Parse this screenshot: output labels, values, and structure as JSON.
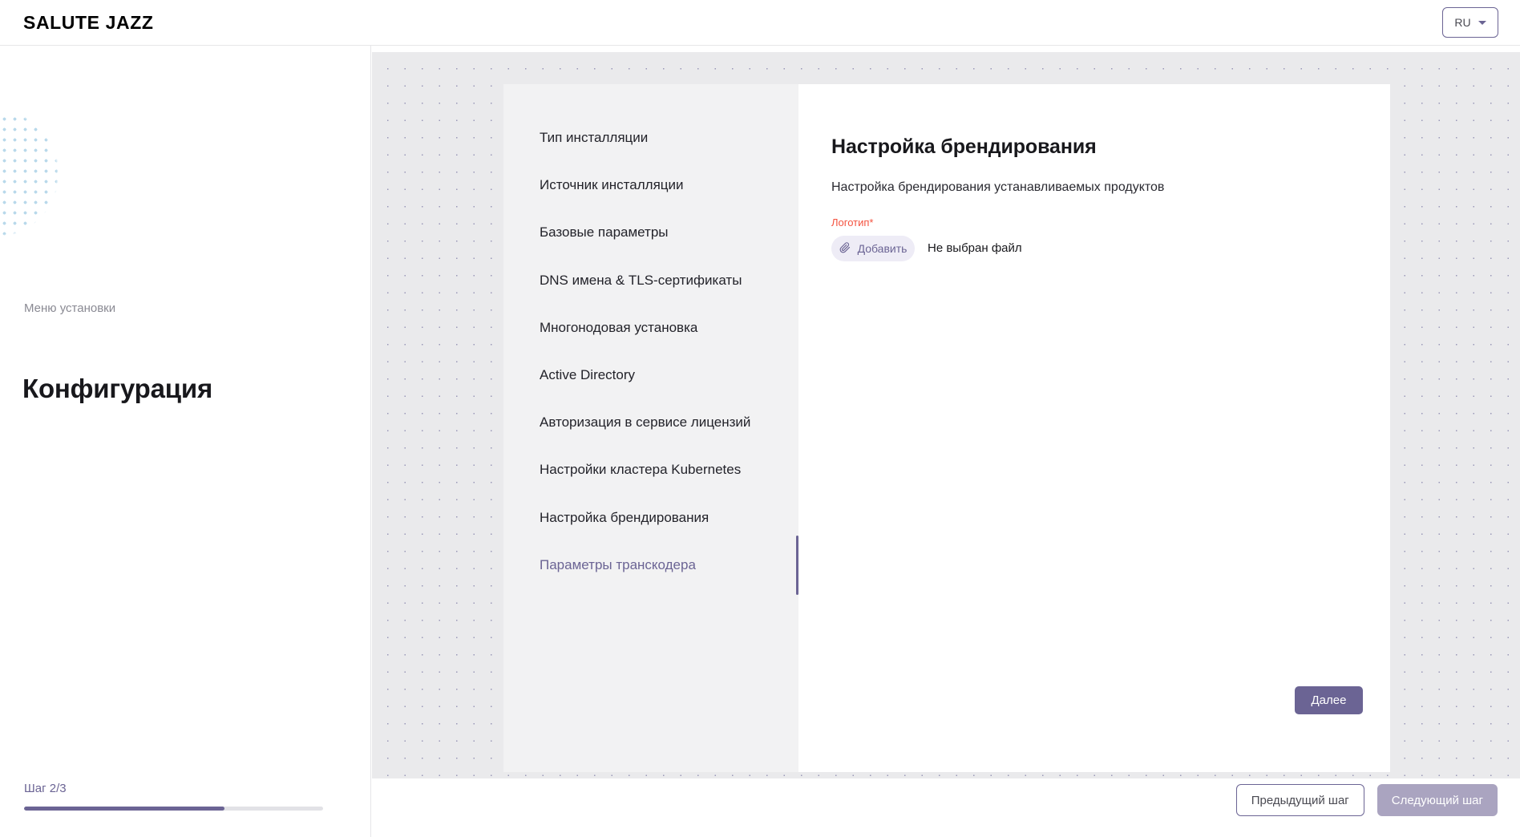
{
  "header": {
    "brand": "SALUTE JAZZ",
    "language": {
      "value": "RU",
      "caret_icon": "chevron-down-icon"
    }
  },
  "sidebar": {
    "eyebrow": "Меню установки",
    "title": "Конфигурация",
    "step": {
      "label": "Шаг 2/3",
      "current": 2,
      "total": 3,
      "percent": 67
    },
    "decoration": "dot-pattern"
  },
  "wizard_nav": {
    "active_index": 9,
    "items": [
      {
        "label": "Тип инсталляции"
      },
      {
        "label": "Источник инсталляции"
      },
      {
        "label": "Базовые параметры"
      },
      {
        "label": "DNS имена & TLS-сертификаты"
      },
      {
        "label": "Многонодовая установка"
      },
      {
        "label": "Active Directory"
      },
      {
        "label": "Авторизация в сервисе лицензий"
      },
      {
        "label": "Настройки кластера Kubernetes"
      },
      {
        "label": "Настройка брендирования"
      },
      {
        "label": "Параметры транскодера"
      }
    ]
  },
  "content": {
    "title": "Настройка брендирования",
    "subtitle": "Настройка брендирования устанавливаемых продуктов",
    "logo_field": {
      "label": "Логотип*",
      "required": true,
      "upload_button": {
        "label": "Добавить",
        "icon": "paperclip-icon"
      },
      "file_status": "Не выбран файл"
    },
    "next_button": "Далее"
  },
  "footer": {
    "prev_button": "Предыдущий шаг",
    "next_button": "Следующий шаг",
    "next_disabled": true
  },
  "colors": {
    "accent": "#6b6494",
    "accent_soft": "#aaa4c0",
    "accent_bg": "#eeecf6",
    "required": "#f4523f",
    "panel": "#f2f2f3",
    "canvas": "#eaeaec",
    "dot_blue": "#b6d8ea"
  }
}
